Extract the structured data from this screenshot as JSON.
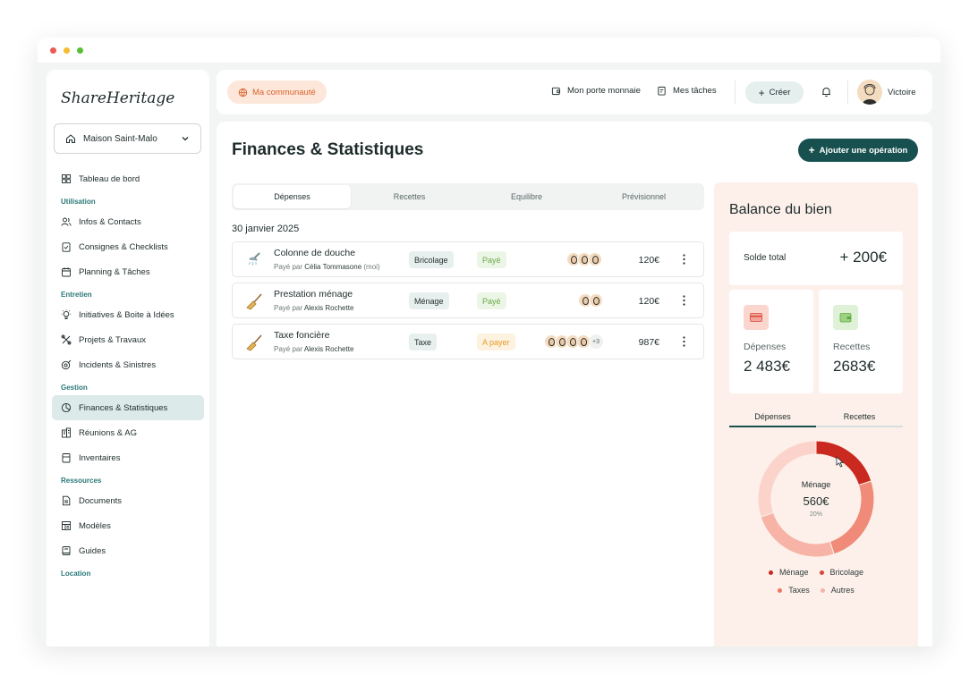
{
  "app": {
    "logo": "ShareHeritage"
  },
  "sidebar": {
    "house": "Maison Saint-Malo",
    "items": [
      {
        "type": "item",
        "label": "Tableau de bord",
        "icon": "dashboard-icon"
      },
      {
        "type": "section",
        "label": "Utilisation"
      },
      {
        "type": "item",
        "label": "Infos & Contacts",
        "icon": "contacts-icon"
      },
      {
        "type": "item",
        "label": "Consignes & Checklists",
        "icon": "checklist-icon"
      },
      {
        "type": "item",
        "label": "Planning & Tâches",
        "icon": "calendar-icon"
      },
      {
        "type": "section",
        "label": "Entretien"
      },
      {
        "type": "item",
        "label": "Initiatives & Boite à Idées",
        "icon": "lightbulb-icon"
      },
      {
        "type": "item",
        "label": "Projets & Travaux",
        "icon": "tools-icon"
      },
      {
        "type": "item",
        "label": "Incidents & Sinistres",
        "icon": "incident-icon"
      },
      {
        "type": "section",
        "label": "Gestion"
      },
      {
        "type": "item",
        "label": "Finances & Statistiques",
        "icon": "pie-chart-icon",
        "active": true
      },
      {
        "type": "item",
        "label": "Réunions & AG",
        "icon": "building-icon"
      },
      {
        "type": "item",
        "label": "Inventaires",
        "icon": "inventory-icon"
      },
      {
        "type": "section",
        "label": "Ressources"
      },
      {
        "type": "item",
        "label": "Documents",
        "icon": "document-icon"
      },
      {
        "type": "item",
        "label": "Modèles",
        "icon": "template-icon"
      },
      {
        "type": "item",
        "label": "Guides",
        "icon": "book-icon"
      },
      {
        "type": "section",
        "label": "Location"
      }
    ]
  },
  "topbar": {
    "community": "Ma communauté",
    "wallet": "Mon porte monnaie",
    "tasks": "Mes tâches",
    "create": "Créer",
    "user": "Victoire"
  },
  "page": {
    "title": "Finances & Statistiques",
    "add_button": "Ajouter une opération",
    "tabs": [
      {
        "label": "Dépenses",
        "active": true
      },
      {
        "label": "Recettes"
      },
      {
        "label": "Equilibre"
      },
      {
        "label": "Prévisionnel"
      }
    ],
    "date": "30 janvier 2025",
    "operations": [
      {
        "title": "Colonne de douche",
        "paid_by_prefix": "Payé par",
        "payer": "Célia Tommasone",
        "payer_suffix": "(moi)",
        "category": "Bricolage",
        "status": "Payé",
        "status_type": "paid",
        "avatars": 3,
        "more": "",
        "amount": "120€",
        "icon": "shower-icon"
      },
      {
        "title": "Prestation ménage",
        "paid_by_prefix": "Payé par",
        "payer": "Alexis Rochette",
        "payer_suffix": "",
        "category": "Ménage",
        "status": "Payé",
        "status_type": "paid",
        "avatars": 2,
        "more": "",
        "amount": "120€",
        "icon": "broom-icon"
      },
      {
        "title": "Taxe foncière",
        "paid_by_prefix": "Payé par",
        "payer": "Alexis Rochette",
        "payer_suffix": "",
        "category": "Taxe",
        "status": "A payer",
        "status_type": "due",
        "avatars": 4,
        "more": "+3",
        "amount": "987€",
        "icon": "broom-icon"
      }
    ]
  },
  "balance": {
    "title": "Balance du bien",
    "solde_label": "Solde total",
    "solde_value": "+ 200€",
    "expenses_label": "Dépenses",
    "expenses_value": "2 483€",
    "income_label": "Recettes",
    "income_value": "2683€",
    "tabs": [
      "Dépenses",
      "Recettes"
    ],
    "donut_center": {
      "label": "Ménage",
      "value": "560€",
      "percent": "20%"
    },
    "legend": [
      {
        "label": "Ménage",
        "color": "#c9291e"
      },
      {
        "label": "Bricolage",
        "color": "#d9473b"
      },
      {
        "label": "Taxes",
        "color": "#ef7560"
      },
      {
        "label": "Autres",
        "color": "#f6b3a6"
      }
    ]
  },
  "chart_data": {
    "type": "pie",
    "categories": [
      "Ménage",
      "Bricolage",
      "Taxes",
      "Autres"
    ],
    "values": [
      20,
      25,
      25,
      30
    ],
    "colors": [
      "#c9291e",
      "#ef8b78",
      "#f6b3a6",
      "#fbd3ca"
    ],
    "title": ""
  }
}
